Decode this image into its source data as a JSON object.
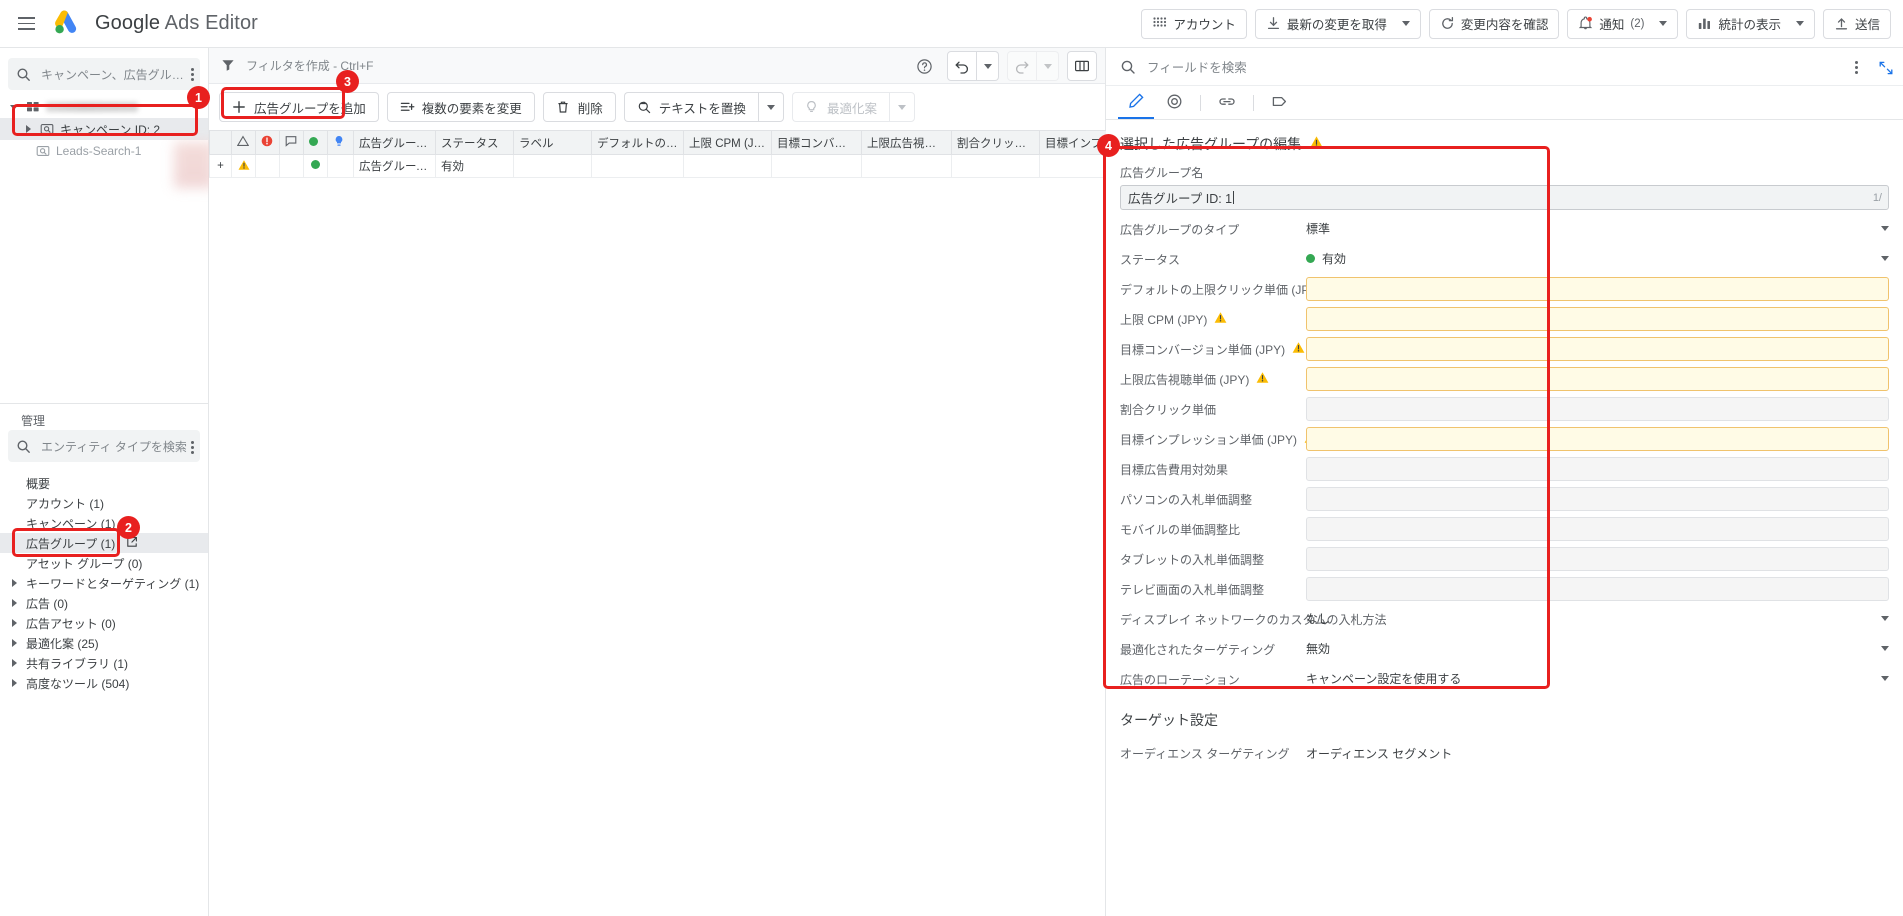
{
  "app": {
    "brand_prefix": "Google",
    "brand_suffix": "Ads Editor",
    "menu_icon": "hamburger-icon"
  },
  "topbar": {
    "buttons": [
      {
        "label": "アカウント",
        "icon": "grid-apps-icon",
        "has_caret": false
      },
      {
        "label": "最新の変更を取得",
        "icon": "download-icon",
        "has_caret": true
      },
      {
        "label": "変更内容を確認",
        "icon": "refresh-icon",
        "has_caret": false
      },
      {
        "label": "通知",
        "count": "(2)",
        "icon": "bell-alert-icon",
        "has_caret": true
      },
      {
        "label": "統計の表示",
        "icon": "bar-chart-icon",
        "has_caret": true
      },
      {
        "label": "送信",
        "icon": "upload-icon",
        "has_caret": false
      }
    ]
  },
  "sidebar": {
    "search_placeholder": "キャンペーン、広告グループ、アセ...",
    "kebab_name": "more-options",
    "tree": [
      {
        "label": "",
        "redacted": true,
        "icon": "account-grid-icon",
        "expander": "open",
        "indent": 0
      },
      {
        "label": "キャンペーン ID: 2",
        "icon": "campaign-icon",
        "expander": "closed",
        "indent": 1,
        "selected": true
      },
      {
        "label": "Leads-Search-1",
        "icon": "search-campaign-icon",
        "expander": "none",
        "indent": 2,
        "selected": false
      }
    ],
    "manage_title": "管理",
    "entity_search_placeholder": "エンティティ タイプを検索",
    "entities": [
      {
        "label": "概要",
        "arrow": false,
        "selected": false
      },
      {
        "label": "アカウント (1)",
        "arrow": false,
        "selected": false
      },
      {
        "label": "キャンペーン (1)",
        "arrow": false,
        "selected": false
      },
      {
        "label": "広告グループ (1)",
        "arrow": false,
        "selected": true,
        "external": true
      },
      {
        "label": "アセット グループ (0)",
        "arrow": false,
        "selected": false
      },
      {
        "label": "キーワードとターゲティング (1)",
        "arrow": true,
        "selected": false
      },
      {
        "label": "広告 (0)",
        "arrow": true,
        "selected": false
      },
      {
        "label": "広告アセット (0)",
        "arrow": true,
        "selected": false
      },
      {
        "label": "最適化案 (25)",
        "arrow": true,
        "selected": false
      },
      {
        "label": "共有ライブラリ (1)",
        "arrow": true,
        "selected": false
      },
      {
        "label": "高度なツール (504)",
        "arrow": true,
        "selected": false
      }
    ]
  },
  "center": {
    "filter_placeholder": "フィルタを作成 - Ctrl+F",
    "filter_icon": "funnel-icon",
    "help_icon": "help-circle-icon",
    "undo_icon": "undo-icon",
    "redo_icon": "redo-icon",
    "columns_icon": "columns-icon",
    "actions": [
      {
        "label": "広告グループを追加",
        "icon": "plus-icon",
        "disabled": false,
        "caret": false
      },
      {
        "label": "複数の要素を変更",
        "icon": "bulk-edit-icon",
        "disabled": false,
        "caret": false
      },
      {
        "label": "削除",
        "icon": "trash-icon",
        "disabled": false,
        "caret": false
      },
      {
        "label": "テキストを置換",
        "icon": "replace-icon",
        "disabled": false,
        "caret": true
      },
      {
        "label": "最適化案",
        "icon": "bulb-icon",
        "disabled": true,
        "caret": true
      }
    ],
    "table": {
      "icon_columns": [
        "warning-triangle-icon",
        "error-circle-icon",
        "comment-icon",
        "status-dot-icon",
        "bulb-icon"
      ],
      "columns": [
        "広告グループ名",
        "ステータス",
        "ラベル",
        "デフォルトの上限ク...",
        "上限 CPM (JPY)",
        "目標コンバージョン...",
        "上限広告視聴単...",
        "割合クリック単価",
        "目標インプレッショ...",
        "目標｡"
      ],
      "rows": [
        {
          "plus": "+",
          "warning": "warning-triangle-icon",
          "status_dot": "#34a853",
          "name": "広告グループ ID: 1",
          "status": "有効",
          "label": "",
          "default_max_cpc": "",
          "max_cpm": "",
          "target_cpa": "",
          "max_cpv": "",
          "percent_cpc": "",
          "target_cpm": "",
          "target_extra": ""
        }
      ]
    }
  },
  "right": {
    "search_placeholder": "フィールドを検索",
    "kebab_name": "panel-more-options",
    "expand_icon": "open-in-full-icon",
    "tabs": [
      {
        "icon": "pencil-icon",
        "active": true
      },
      {
        "icon": "target-icon",
        "active": false
      },
      {
        "icon": "link-icon",
        "active": false
      },
      {
        "icon": "label-tag-icon",
        "active": false
      }
    ],
    "title": "選択した広告グループの編集",
    "title_warning": "warning-triangle-icon",
    "name_field": {
      "label": "広告グループ名",
      "value": "広告グループ ID: 1",
      "counter": "1/"
    },
    "fields": [
      {
        "label": "広告グループのタイプ",
        "type": "select",
        "value": "標準",
        "warn": false
      },
      {
        "label": "ステータス",
        "type": "select-dot",
        "value": "有効",
        "dot": "#34a853",
        "warn": false
      },
      {
        "label": "デフォルトの上限クリック単価 (JPY)",
        "type": "input-warn",
        "value": "",
        "warn": true
      },
      {
        "label": "上限 CPM (JPY)",
        "type": "input-warn",
        "value": "",
        "warn": true
      },
      {
        "label": "目標コンバージョン単価 (JPY)",
        "type": "input-warn",
        "value": "",
        "warn": true
      },
      {
        "label": "上限広告視聴単価 (JPY)",
        "type": "input-warn",
        "value": "",
        "warn": true
      },
      {
        "label": "割合クリック単価",
        "type": "input",
        "value": "",
        "warn": false
      },
      {
        "label": "目標インプレッション単価 (JPY)",
        "type": "input-warn",
        "value": "",
        "warn": true
      },
      {
        "label": "目標広告費用対効果",
        "type": "input",
        "value": "",
        "warn": false
      },
      {
        "label": "パソコンの入札単価調整",
        "type": "input",
        "value": "",
        "warn": false
      },
      {
        "label": "モバイルの単価調整比",
        "type": "input",
        "value": "",
        "warn": false
      },
      {
        "label": "タブレットの入札単価調整",
        "type": "input",
        "value": "",
        "warn": false
      },
      {
        "label": "テレビ画面の入札単価調整",
        "type": "input",
        "value": "",
        "warn": false
      },
      {
        "label": "ディスプレイ ネットワークのカスタムの入札方法",
        "type": "select",
        "value": "なし",
        "warn": false
      },
      {
        "label": "最適化されたターゲティング",
        "type": "select",
        "value": "無効",
        "warn": false
      },
      {
        "label": "広告のローテーション",
        "type": "select",
        "value": "キャンペーン設定を使用する",
        "warn": false
      }
    ],
    "target_section": {
      "title": "ターゲット設定",
      "row_label": "オーディエンス ターゲティング",
      "row_value": "オーディエンス セグメント"
    }
  },
  "annotations": {
    "markers": [
      {
        "number": "1",
        "target": "sidebar-campaign-row"
      },
      {
        "number": "2",
        "target": "entity-adgroup-row"
      },
      {
        "number": "3",
        "target": "add-adgroup-button"
      },
      {
        "number": "4",
        "target": "edit-panel-form"
      }
    ],
    "color": "#e8201f"
  }
}
